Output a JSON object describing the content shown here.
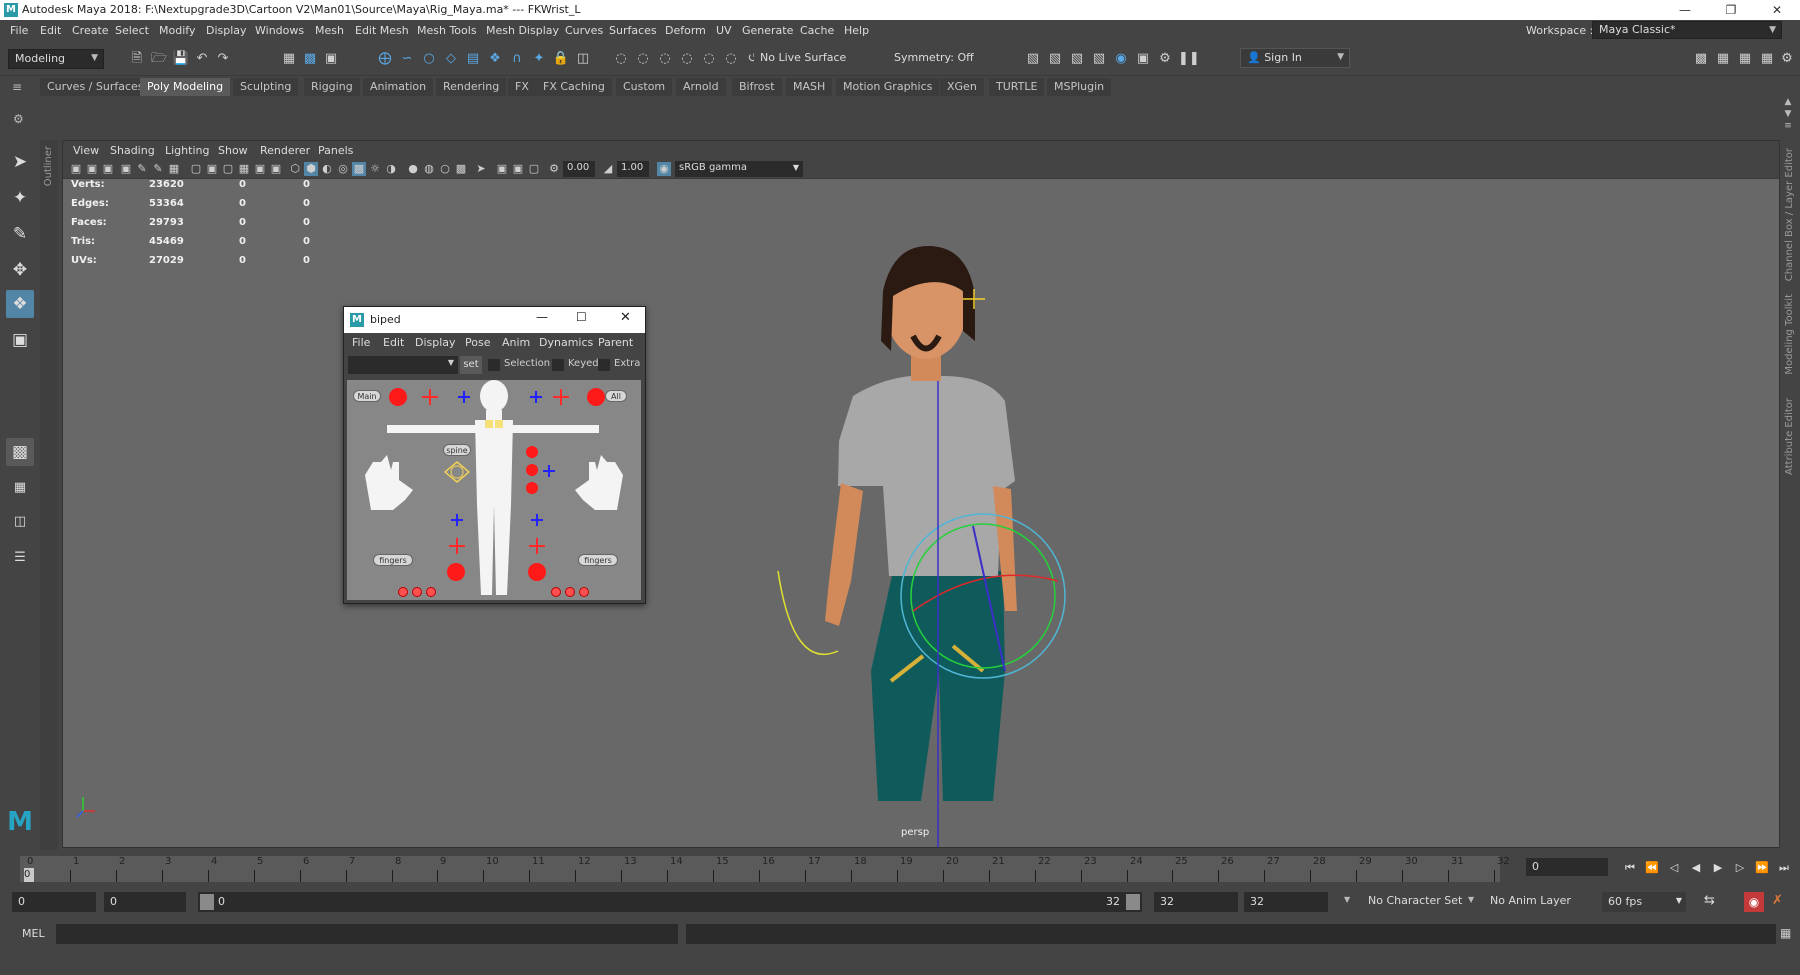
{
  "window": {
    "title": "Autodesk Maya 2018: F:\\Nextupgrade3D\\Cartoon V2\\Man01\\Source\\Maya\\Rig_Maya.ma*  ---  FKWrist_L",
    "icon": "M"
  },
  "menubar": [
    "File",
    "Edit",
    "Create",
    "Select",
    "Modify",
    "Display",
    "Windows",
    "Mesh",
    "Edit Mesh",
    "Mesh Tools",
    "Mesh Display",
    "Curves",
    "Surfaces",
    "Deform",
    "UV",
    "Generate",
    "Cache",
    "Help"
  ],
  "workspace": {
    "label": "Workspace :",
    "value": "Maya Classic*"
  },
  "status": {
    "menuset": "Modeling",
    "live_surface": "No Live Surface",
    "symmetry": "Symmetry: Off",
    "sign_in": "Sign In"
  },
  "shelf_tabs": [
    "Curves / Surfaces",
    "Poly Modeling",
    "Sculpting",
    "Rigging",
    "Animation",
    "Rendering",
    "FX",
    "FX Caching",
    "Custom",
    "Arnold",
    "Bifrost",
    "MASH",
    "Motion Graphics",
    "XGen",
    "TURTLE",
    "MSPlugin"
  ],
  "shelf_active": "Poly Modeling",
  "viewport": {
    "menu": [
      "View",
      "Shading",
      "Lighting",
      "Show",
      "Renderer",
      "Panels"
    ],
    "exposure": "0.00",
    "gamma": "1.00",
    "colorspace": "sRGB gamma",
    "camera": "persp",
    "hud": [
      {
        "label": "Verts:",
        "v1": "23620",
        "v2": "0",
        "v3": "0"
      },
      {
        "label": "Edges:",
        "v1": "53364",
        "v2": "0",
        "v3": "0"
      },
      {
        "label": "Faces:",
        "v1": "29793",
        "v2": "0",
        "v3": "0"
      },
      {
        "label": "Tris:",
        "v1": "45469",
        "v2": "0",
        "v3": "0"
      },
      {
        "label": "UVs:",
        "v1": "27029",
        "v2": "0",
        "v3": "0"
      }
    ]
  },
  "side_labels": {
    "outliner": "Outliner",
    "channel_box": "Channel Box / Layer Editor",
    "modeling_toolkit": "Modeling Toolkit",
    "attribute_editor": "Attribute Editor"
  },
  "biped": {
    "title": "biped",
    "menu": [
      "File",
      "Edit",
      "Display",
      "Pose",
      "Anim",
      "Dynamics",
      "Parent"
    ],
    "set_label": "set",
    "selection": "Selection",
    "keyed": "Keyed",
    "extra": "Extra",
    "main": "Main",
    "all": "All",
    "spine": "spine",
    "fingers_l": "fingers",
    "fingers_r": "fingers"
  },
  "timeline": {
    "ticks": [
      "0",
      "1",
      "2",
      "3",
      "4",
      "5",
      "6",
      "7",
      "8",
      "9",
      "10",
      "11",
      "12",
      "13",
      "14",
      "15",
      "16",
      "17",
      "18",
      "19",
      "20",
      "21",
      "22",
      "23",
      "24",
      "25",
      "26",
      "27",
      "28",
      "29",
      "30",
      "31",
      "32"
    ],
    "current_frame": "0",
    "current_field": "0"
  },
  "range": {
    "start": "0",
    "anim_start": "0",
    "slider_start": "0",
    "slider_end": "32",
    "end": "32",
    "anim_end": "32",
    "character_set": "No Character Set",
    "anim_layer": "No Anim Layer",
    "fps": "60 fps"
  },
  "cmdline": {
    "lang": "MEL"
  }
}
